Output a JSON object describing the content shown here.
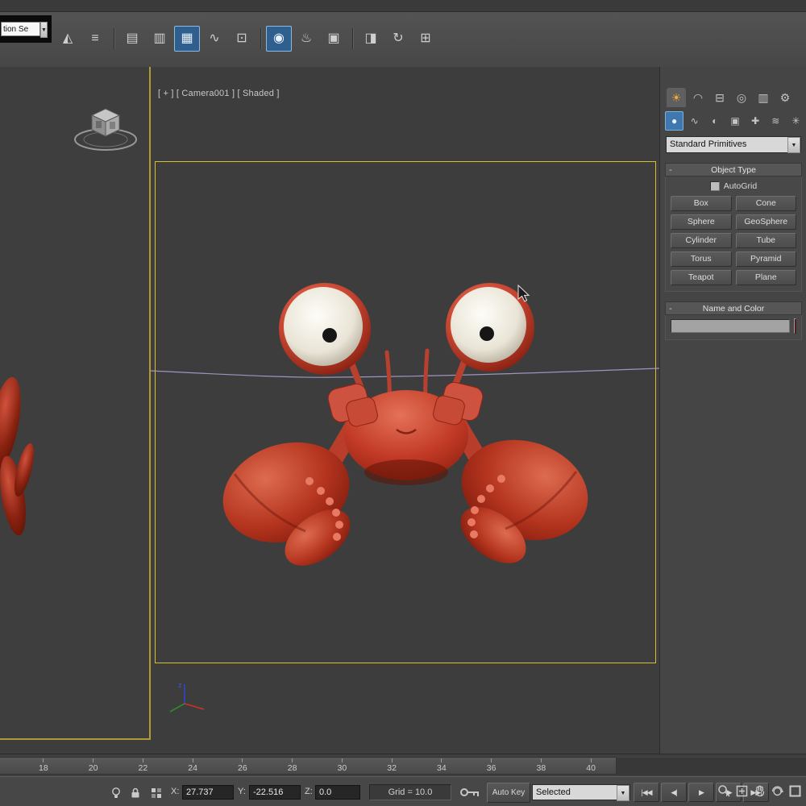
{
  "glyphs": {
    "dropdown_arrow": "▼"
  },
  "toolbar": {
    "selection_combo_value": "tion Se",
    "icons": [
      {
        "name": "mirror",
        "glyph": "◭"
      },
      {
        "name": "align",
        "glyph": "≡"
      },
      {
        "name": "layer-manager",
        "glyph": "▤"
      },
      {
        "name": "scene-explorer",
        "glyph": "▥"
      },
      {
        "name": "ribbon-toggle",
        "glyph": "▦"
      },
      {
        "name": "curve-editor",
        "glyph": "∿"
      },
      {
        "name": "schematic-view",
        "glyph": "⊡"
      },
      {
        "name": "material-editor",
        "glyph": "◉"
      },
      {
        "name": "render-setup",
        "glyph": "♨"
      },
      {
        "name": "rendered-frame-window",
        "glyph": "▣"
      },
      {
        "name": "render-production",
        "glyph": "◨"
      },
      {
        "name": "render-iterative",
        "glyph": "↻"
      },
      {
        "name": "uvw-editor",
        "glyph": "⊞"
      }
    ]
  },
  "viewport": {
    "camera_label": "[ + ] [ Camera001 ] [ Shaded ]",
    "axis_z_label": "z"
  },
  "command_panel": {
    "tabs": [
      {
        "name": "create",
        "glyph": "☀"
      },
      {
        "name": "modify",
        "glyph": "◠"
      },
      {
        "name": "hierarchy",
        "glyph": "⊟"
      },
      {
        "name": "motion",
        "glyph": "◎"
      },
      {
        "name": "display",
        "glyph": "▥"
      },
      {
        "name": "utilities",
        "glyph": "⚙"
      }
    ],
    "categories": [
      {
        "name": "geometry",
        "glyph": "●"
      },
      {
        "name": "shapes",
        "glyph": "∿"
      },
      {
        "name": "lights",
        "glyph": "◐"
      },
      {
        "name": "cameras",
        "glyph": "▣"
      },
      {
        "name": "helpers",
        "glyph": "✚"
      },
      {
        "name": "space-warps",
        "glyph": "≋"
      },
      {
        "name": "systems",
        "glyph": "✳"
      }
    ],
    "subcategory_dropdown": "Standard Primitives",
    "object_type": {
      "title": "Object Type",
      "collapse_glyph": "-",
      "autogrid_label": "AutoGrid",
      "buttons": [
        "Box",
        "Cone",
        "Sphere",
        "GeoSphere",
        "Cylinder",
        "Tube",
        "Torus",
        "Pyramid",
        "Teapot",
        "Plane"
      ]
    },
    "name_and_color": {
      "title": "Name and Color",
      "collapse_glyph": "-",
      "name_value": "",
      "swatch_color": "#7c0b10"
    },
    "accent_colors": {
      "active_tab_glyph": "#f2a93b",
      "active_category_bg": "#3e78ae",
      "viewport_border": "#d9be2e",
      "toolbar_active_bg": "#2f5f8f"
    }
  },
  "timeline": {
    "ticks": [
      "18",
      "20",
      "22",
      "24",
      "26",
      "28",
      "30",
      "32",
      "34",
      "36",
      "38",
      "40"
    ]
  },
  "status_bar": {
    "x_label": "X:",
    "x_value": "27.737",
    "y_label": "Y:",
    "y_value": "-22.516",
    "z_label": "Z:",
    "z_value": "0.0",
    "grid_readout": "Grid = 10.0",
    "auto_key_label": "Auto Key",
    "selected_filter_value": "Selected",
    "transport": {
      "go_start": "|◀◀",
      "prev_frame": "◀|",
      "play": "▶",
      "next_frame": "|▶",
      "go_end": "▶▶|"
    }
  }
}
